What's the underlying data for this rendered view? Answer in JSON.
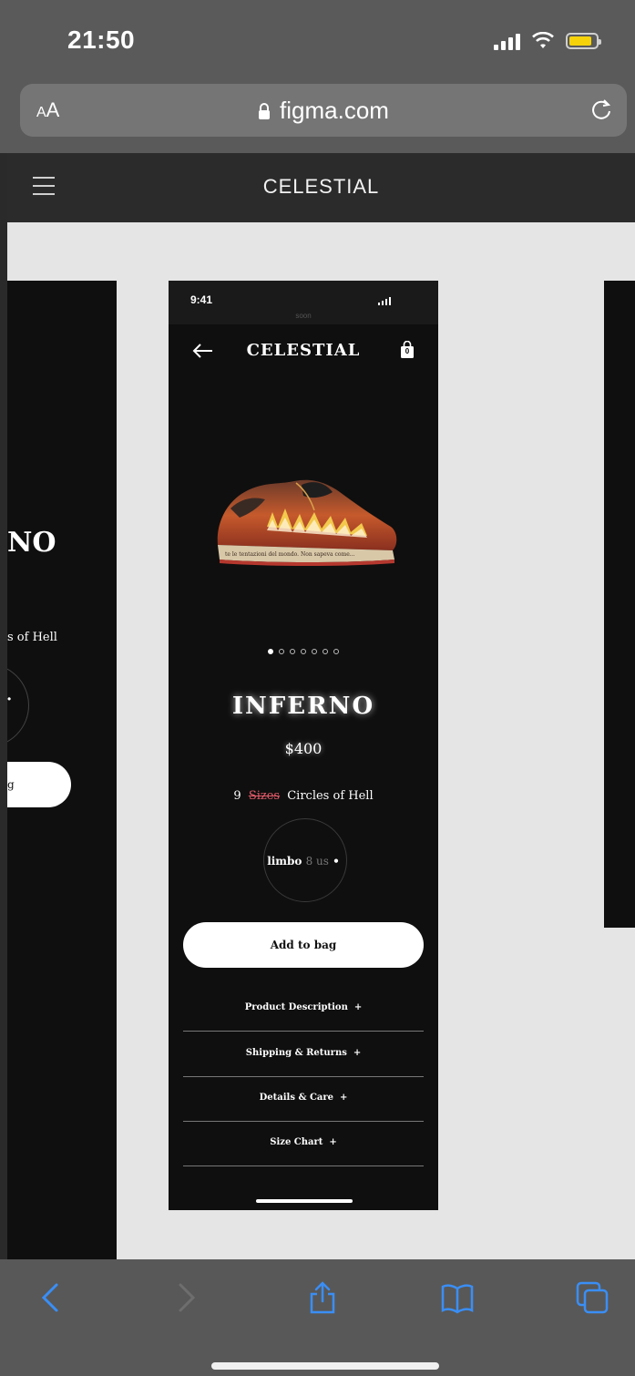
{
  "status_bar": {
    "time": "21:50"
  },
  "address_bar": {
    "aa_label_small": "A",
    "aa_label_large": "A",
    "url": "figma.com"
  },
  "figma_header": {
    "title": "CELESTIAL"
  },
  "left_frame": {
    "title": "NO",
    "circles_text": "s of Hell",
    "ring_label": "•",
    "button_label": "g"
  },
  "phone": {
    "time": "9:41",
    "notch_text": "soon",
    "brand": "CELESTIAL",
    "bag_count": "0",
    "product_name": "INFERNO",
    "price": "$400",
    "circles": {
      "prefix": "9",
      "struck": "Sizes",
      "suffix": "Circles of Hell"
    },
    "size": {
      "name": "limbo",
      "us": "8 us",
      "chevron": "•"
    },
    "add_button": "Add to bag",
    "accordion": [
      {
        "label": "Product Description",
        "icon": "+"
      },
      {
        "label": "Shipping & Returns",
        "icon": "+"
      },
      {
        "label": "Details & Care",
        "icon": "+"
      },
      {
        "label": "Size Chart",
        "icon": "+"
      }
    ],
    "carousel": {
      "count": 7,
      "active": 0
    }
  },
  "colors": {
    "accent_blue": "#3a8ef5",
    "strike_red": "#e45b6a",
    "battery_yellow": "#f5d20a"
  },
  "icons": {
    "browser_back": "chevron-left-icon",
    "browser_forward": "chevron-right-icon",
    "share": "share-icon",
    "bookmarks": "book-icon",
    "tabs": "tabs-icon"
  }
}
